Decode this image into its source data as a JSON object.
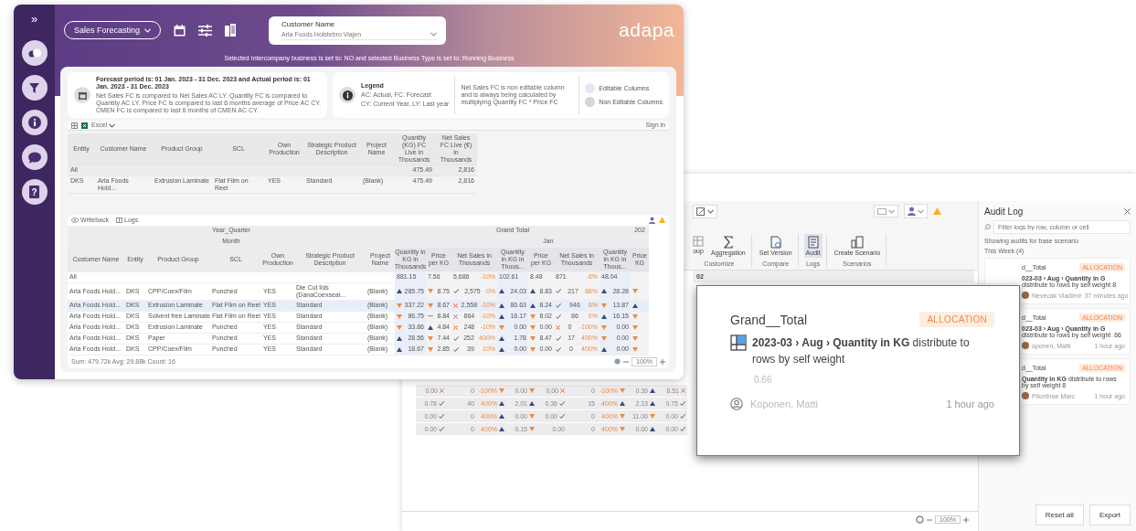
{
  "left_window": {
    "sidebar": {
      "expand": "»",
      "items": [
        {
          "kind": "toggle"
        },
        {
          "kind": "filter"
        },
        {
          "kind": "info"
        },
        {
          "kind": "chat"
        },
        {
          "kind": "help",
          "glyph": "?"
        }
      ]
    },
    "header": {
      "view_dropdown": "Sales Forecasting",
      "tools": [
        {
          "kind": "calendar"
        },
        {
          "kind": "sliders"
        },
        {
          "kind": "buildings"
        }
      ],
      "customer_label": "Customer Name",
      "customer_value": "Arla Foods Holstebro Viajen",
      "logo": "adapa",
      "notice": "Selected Intercompany business is set to: NO and selected Business Type is set to: Running Business"
    },
    "period_card": {
      "title": "Forecast period is: 01 Jan. 2023 - 31 Dec. 2023 and Actual period is: 01 Jan. 2023 - 31 Dec. 2023",
      "body": "Net Sales FC is compared to Net Sales AC LY. Quantity FC is compared to Quantity AC LY. Price FC is compared to last 6 months average of Price AC CY. CMEN FC is compared to last 6 months of CMEN AC CY."
    },
    "legend": {
      "title": "Legend",
      "lines": [
        "AC: Actual, FC: Forecast",
        "CY: Current Year, LY: Last year"
      ],
      "note": "Net Sales FC is non editable column and is always being calculated by multiplying Quantity FC * Price FC",
      "items": [
        {
          "label": "Editable Columns",
          "color": "#e3e8f7"
        },
        {
          "label": "Non Editable Columns",
          "color": "#d6d6d8"
        }
      ]
    },
    "toolbar": {
      "excel": "Excel",
      "sign_in": "Sign in"
    },
    "summary_table": {
      "columns": [
        "Entity",
        "Customer Name",
        "Product Group",
        "SCL",
        "Own Production",
        "Strategic Product Description",
        "Project Name",
        "Quantity (KG) FC Live in Thousands",
        "Net Sales FC Live (€) in Thousands"
      ],
      "total_row": {
        "label": "All",
        "values": [
          "475.49",
          "2,816"
        ]
      },
      "rows": [
        [
          "DKS",
          "Arla Foods Hold...",
          "Extrusion Laminate",
          "Flat Film on Reel",
          "YES",
          "Standard",
          "(Blank)",
          "475.49",
          "2,816"
        ]
      ]
    },
    "grid_toolbar": {
      "writeback": "Writeback",
      "logs": "Logs"
    },
    "grid": {
      "year_header": "Year_Quarter",
      "month_header": "Month",
      "total_header": "Grand Total",
      "next_header": "202",
      "jan_header": "Jan",
      "columns": [
        "Customer Name",
        "Entity",
        "Product Group",
        "SCL",
        "Own Production",
        "Strategic Product Description",
        "Project Name"
      ],
      "value_columns": [
        "Quantity in KG in Thousands",
        "Price per KG",
        "Net Sales in Thousands",
        "Quantity in KG in Thous...",
        "Price per KG",
        "Net Sales in Thousands",
        "Quantity in KG in Thous...",
        "Price KG"
      ],
      "rows": [
        {
          "selected": false,
          "cells": [
            "All"
          ],
          "values": [
            {
              "kind": "none",
              "t": "881.15"
            },
            {
              "kind": "none",
              "t": "7.56"
            },
            {
              "kind": "none",
              "t": "5,686",
              "p": "-10%"
            },
            {
              "kind": "none",
              "t": "102.61"
            },
            {
              "kind": "none",
              "t": "8.48"
            },
            {
              "kind": "none",
              "t": "871",
              "p": "-6%"
            },
            {
              "kind": "none",
              "t": "48.04"
            }
          ]
        },
        {
          "selected": false,
          "cells": [
            "Arla Foods Hold...",
            "DKS",
            "CPP/Coex/Film",
            "Punched",
            "YES",
            "Die Cut lids (DanaCoexseal...",
            "(Blank)"
          ],
          "values": [
            {
              "kind": "up",
              "t": "285.75"
            },
            {
              "kind": "down",
              "t": "8.75"
            },
            {
              "kind": "check",
              "t": "2,575",
              "p": "0%"
            },
            {
              "kind": "up",
              "t": "24.03"
            },
            {
              "kind": "up",
              "t": "8.83"
            },
            {
              "kind": "check",
              "t": "217",
              "p": "88%"
            },
            {
              "kind": "up",
              "t": "28.28"
            },
            {
              "kind": "down"
            }
          ]
        },
        {
          "selected": true,
          "cells": [
            "Arla Foods Hold...",
            "DKS",
            "Extrusion Laminate",
            "Flat Film on Reel",
            "YES",
            "Standard",
            "(Blank)"
          ],
          "values": [
            {
              "kind": "down",
              "t": "337.22"
            },
            {
              "kind": "down",
              "t": "8.67"
            },
            {
              "kind": "cross",
              "t": "2,558",
              "p": "-10%"
            },
            {
              "kind": "up",
              "t": "86.63"
            },
            {
              "kind": "up",
              "t": "8.24"
            },
            {
              "kind": "check",
              "t": "946",
              "p": "6%"
            },
            {
              "kind": "down",
              "t": "13.87"
            },
            {
              "kind": "up"
            }
          ]
        },
        {
          "selected": false,
          "cells": [
            "Arla Foods Hold...",
            "DKS",
            "Solvent free Laminate",
            "Flat Film on Reel",
            "YES",
            "Standard",
            "(Blank)"
          ],
          "values": [
            {
              "kind": "down",
              "t": "86.75"
            },
            {
              "kind": "flat",
              "t": "8.84"
            },
            {
              "kind": "cross",
              "t": "864",
              "p": "-10%"
            },
            {
              "kind": "up",
              "t": "16.17"
            },
            {
              "kind": "down",
              "t": "8.02"
            },
            {
              "kind": "check",
              "t": "86",
              "p": "0%"
            },
            {
              "kind": "up",
              "t": "16.15"
            },
            {
              "kind": "down"
            }
          ]
        },
        {
          "selected": false,
          "cells": [
            "Arla Foods Hold...",
            "DKS",
            "Extrusion Laminate",
            "Punched",
            "YES",
            "Standard",
            "(Blank)"
          ],
          "values": [
            {
              "kind": "down",
              "t": "33.86"
            },
            {
              "kind": "up",
              "t": "4.84"
            },
            {
              "kind": "cross",
              "t": "248",
              "p": "-10%"
            },
            {
              "kind": "down",
              "t": "0.00"
            },
            {
              "kind": "down",
              "t": "0.00"
            },
            {
              "kind": "cross",
              "t": "0",
              "p": "-100%"
            },
            {
              "kind": "down",
              "t": "0.00"
            },
            {
              "kind": "down"
            }
          ]
        },
        {
          "selected": false,
          "cells": [
            "Arla Foods Hold...",
            "DKS",
            "Paper",
            "Punched",
            "YES",
            "Standard",
            "(Blank)"
          ],
          "values": [
            {
              "kind": "up",
              "t": "28.56"
            },
            {
              "kind": "down",
              "t": "7.44"
            },
            {
              "kind": "check",
              "t": "252",
              "p": "400%"
            },
            {
              "kind": "up",
              "t": "1.78"
            },
            {
              "kind": "down",
              "t": "8.47"
            },
            {
              "kind": "check",
              "t": "17",
              "p": "400%"
            },
            {
              "kind": "down",
              "t": "0.00"
            },
            {
              "kind": "down"
            }
          ]
        },
        {
          "selected": false,
          "cells": [
            "Arla Foods Hold...",
            "DKS",
            "CPP/Coex/Film",
            "Punched",
            "YES",
            "Standard",
            "(Blank)"
          ],
          "values": [
            {
              "kind": "up",
              "t": "18.67"
            },
            {
              "kind": "down",
              "t": "2.85"
            },
            {
              "kind": "check",
              "t": "39",
              "p": "10%"
            },
            {
              "kind": "up",
              "t": "0.00"
            },
            {
              "kind": "down",
              "t": "0.00"
            },
            {
              "kind": "check",
              "t": "0",
              "p": "400%"
            },
            {
              "kind": "up",
              "t": "0.00"
            },
            {
              "kind": "down"
            }
          ]
        }
      ]
    },
    "status": "Sum: 479.72k   Avg: 29.88k   Count: 16",
    "zoom": "100%"
  },
  "right_window": {
    "ribbon": {
      "groups": [
        {
          "label": "Customize",
          "buttons": [
            {
              "kind": "group",
              "label": "oup",
              "selected": false
            },
            {
              "kind": "sigma",
              "label": "Aggregation",
              "selected": false
            }
          ]
        },
        {
          "label": "Compare",
          "buttons": [
            {
              "kind": "version",
              "label": "Set Version",
              "selected": false
            }
          ]
        },
        {
          "label": "Logs",
          "buttons": [
            {
              "kind": "audit",
              "label": "Audit",
              "selected": true
            }
          ]
        },
        {
          "label": "Scenarios",
          "buttons": [
            {
              "kind": "scenario",
              "label": "Create Scenario",
              "selected": false
            }
          ]
        }
      ]
    },
    "column_header": "02",
    "rows": [
      [
        {
          "t": "0.00",
          "kind": "cross"
        },
        {
          "t": "0",
          "kind": "none"
        },
        {
          "p": "-100%",
          "kind": "down"
        },
        {
          "t": "0.00",
          "kind": "down"
        },
        {
          "t": "0.00",
          "kind": "cross"
        },
        {
          "t": "0",
          "kind": "none"
        },
        {
          "p": "-100%",
          "kind": "down"
        },
        {
          "t": "0.39",
          "kind": "up"
        },
        {
          "t": "6.51",
          "kind": "cross"
        }
      ],
      [
        {
          "t": "0.78",
          "kind": "check"
        },
        {
          "t": "40",
          "kind": "none"
        },
        {
          "p": "400%",
          "kind": "up"
        },
        {
          "t": "2.01",
          "kind": "up"
        },
        {
          "t": "0.36",
          "kind": "check"
        },
        {
          "t": "15",
          "kind": "none"
        },
        {
          "p": "400%",
          "kind": "up"
        },
        {
          "t": "2.13",
          "kind": "up"
        },
        {
          "t": "0.75",
          "kind": "check"
        }
      ],
      [
        {
          "t": "0.00",
          "kind": "check"
        },
        {
          "t": "0",
          "kind": "none"
        },
        {
          "p": "400%",
          "kind": "up"
        },
        {
          "t": "0.00",
          "kind": "down"
        },
        {
          "t": "0.00",
          "kind": "check"
        },
        {
          "t": "0",
          "kind": "none"
        },
        {
          "p": "400%",
          "kind": "down"
        },
        {
          "t": "11.00",
          "kind": "down"
        },
        {
          "t": "0.00",
          "kind": "check"
        }
      ],
      [
        {
          "t": "0.00",
          "kind": "check"
        },
        {
          "t": "0",
          "kind": "none"
        },
        {
          "p": "400%",
          "kind": "up"
        },
        {
          "t": "0.15",
          "kind": "down"
        },
        {
          "t": "0.00",
          "kind": "none"
        },
        {
          "t": "0",
          "kind": "none"
        },
        {
          "p": "400%",
          "kind": "down"
        },
        {
          "t": "0.00",
          "kind": "up"
        },
        {
          "t": "0.00",
          "kind": "check"
        }
      ]
    ],
    "zoom": "100%",
    "audit": {
      "title": "Audit Log",
      "search_placeholder": "Filter logs by row, column or cell",
      "scope": "Showing audits for base scenario",
      "section": "This Week (4)",
      "entries": [
        {
          "title": "d__Total",
          "badge": "ALLOCATION",
          "text": "**023-03 › Aug › Quantity in** **G** distribute to rows by self weight 8",
          "user": "Nevecak Vladimir",
          "time": "37 minutes ago"
        },
        {
          "title": "d__Total",
          "badge": "ALLOCATION",
          "text": "**023-03 › Aug › Quantity in** **G** distribute to rows by self weight .66",
          "user": "oponen, Matti",
          "time": "1 hour ago"
        },
        {
          "title": "d__Total",
          "badge": "ALLOCATION",
          "text": "**Quantity in KG** distribute to rows by self weight 8",
          "user": "Pilonbrae Marc",
          "time": "1 hour ago"
        }
      ],
      "buttons": [
        "Reset all",
        "Export"
      ]
    }
  },
  "callout": {
    "title": "Grand__Total",
    "badge": "ALLOCATION",
    "text": "**2023-03 › Aug › Quantity in KG** distribute to rows by self weight",
    "value": "0.66",
    "user": "Koponen, Matti",
    "time": "1 hour ago"
  }
}
